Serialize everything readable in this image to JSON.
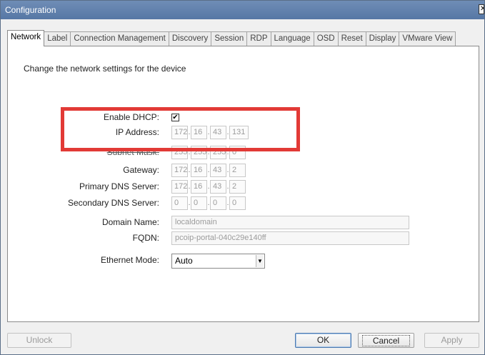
{
  "window": {
    "title": "Configuration",
    "close_glyph": "✕"
  },
  "tabs": [
    "Network",
    "Label",
    "Connection Management",
    "Discovery",
    "Session",
    "RDP",
    "Language",
    "OSD",
    "Reset",
    "Display",
    "VMware View"
  ],
  "description": "Change the network settings for the device",
  "fields": {
    "dhcp": {
      "label": "Enable DHCP:",
      "checked": "✔"
    },
    "ip": {
      "label": "IP Address:",
      "octets": [
        "172",
        "16",
        "43",
        "131"
      ]
    },
    "subnet": {
      "label": "Subnet Mask:",
      "octets": [
        "255",
        "255",
        "255",
        "0"
      ]
    },
    "gateway": {
      "label": "Gateway:",
      "octets": [
        "172",
        "16",
        "43",
        "2"
      ]
    },
    "dns1": {
      "label": "Primary DNS Server:",
      "octets": [
        "172",
        "16",
        "43",
        "2"
      ]
    },
    "dns2": {
      "label": "Secondary DNS Server:",
      "octets": [
        "0",
        "0",
        "0",
        "0"
      ]
    },
    "domain": {
      "label": "Domain Name:",
      "value": "localdomain"
    },
    "fqdn": {
      "label": "FQDN:",
      "value": "pcoip-portal-040c29e140ff"
    },
    "ethernet": {
      "label": "Ethernet Mode:",
      "value": "Auto",
      "arrow": "▼"
    }
  },
  "buttons": {
    "unlock": "Unlock",
    "ok": "OK",
    "cancel": "Cancel",
    "apply": "Apply"
  },
  "colors": {
    "title_bar": "#5f7fae",
    "highlight_box": "#e23a36"
  },
  "icons": {
    "close": "close-icon",
    "dropdown": "chevron-down-icon",
    "checkbox": "checkmark-icon"
  }
}
